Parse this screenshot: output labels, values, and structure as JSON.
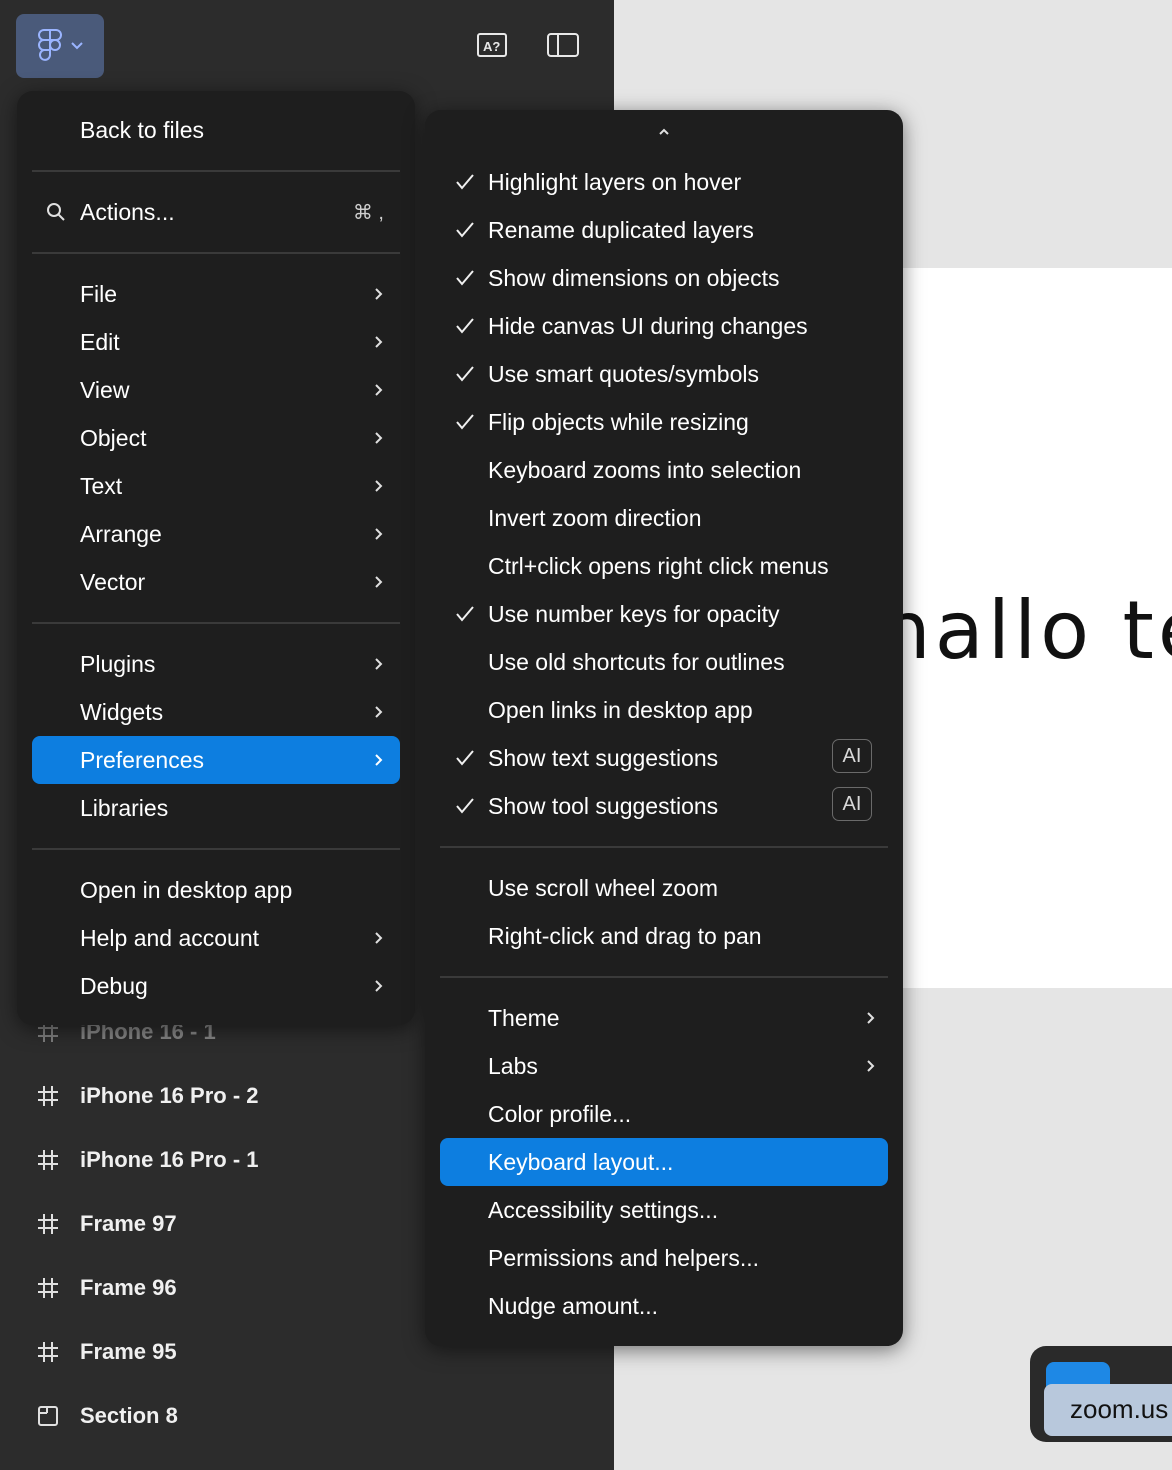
{
  "toolbar": {
    "logo_icon": "figma-logo-icon",
    "dropdown_icon": "chevron-down-icon",
    "font_icon": "missing-fonts-icon",
    "panel_icon": "sidebar-toggle-icon"
  },
  "layers": [
    {
      "name": "iPhone 16 - 1",
      "icon": "frame-icon"
    },
    {
      "name": "iPhone 16 Pro - 2",
      "icon": "frame-icon"
    },
    {
      "name": "iPhone 16 Pro - 1",
      "icon": "frame-icon"
    },
    {
      "name": "Frame 97",
      "icon": "frame-icon"
    },
    {
      "name": "Frame 96",
      "icon": "frame-icon"
    },
    {
      "name": "Frame 95",
      "icon": "frame-icon"
    },
    {
      "name": "Section 8",
      "icon": "section-icon"
    }
  ],
  "canvas": {
    "frame_text": "hallo te"
  },
  "zoom": {
    "tooltip": "zoom.us"
  },
  "main_menu": {
    "back": "Back to files",
    "actions": "Actions...",
    "actions_shortcut": "⌘ ,",
    "items_group1": [
      "File",
      "Edit",
      "View",
      "Object",
      "Text",
      "Arrange",
      "Vector"
    ],
    "items_group2": [
      "Plugins",
      "Widgets",
      "Preferences",
      "Libraries"
    ],
    "items_group3": [
      "Open in desktop app",
      "Help and account",
      "Debug"
    ],
    "active_item": "Preferences"
  },
  "preferences_menu": {
    "toggles": [
      {
        "label": "Highlight layers on hover",
        "checked": true
      },
      {
        "label": "Rename duplicated layers",
        "checked": true
      },
      {
        "label": "Show dimensions on objects",
        "checked": true
      },
      {
        "label": "Hide canvas UI during changes",
        "checked": true
      },
      {
        "label": "Use smart quotes/symbols",
        "checked": true
      },
      {
        "label": "Flip objects while resizing",
        "checked": true
      },
      {
        "label": "Keyboard zooms into selection",
        "checked": false
      },
      {
        "label": "Invert zoom direction",
        "checked": false
      },
      {
        "label": "Ctrl+click opens right click menus",
        "checked": false
      },
      {
        "label": "Use number keys for opacity",
        "checked": true
      },
      {
        "label": "Use old shortcuts for outlines",
        "checked": false
      },
      {
        "label": "Open links in desktop app",
        "checked": false
      },
      {
        "label": "Show text suggestions",
        "checked": true,
        "badge": "AI"
      },
      {
        "label": "Show tool suggestions",
        "checked": true,
        "badge": "AI"
      }
    ],
    "scroll_items": [
      "Use scroll wheel zoom",
      "Right-click and drag to pan"
    ],
    "settings_items": [
      {
        "label": "Theme",
        "submenu": true
      },
      {
        "label": "Labs",
        "submenu": true
      },
      {
        "label": "Color profile...",
        "submenu": false
      },
      {
        "label": "Keyboard layout...",
        "submenu": false
      },
      {
        "label": "Accessibility settings...",
        "submenu": false
      },
      {
        "label": "Permissions and helpers...",
        "submenu": false
      },
      {
        "label": "Nudge amount...",
        "submenu": false
      }
    ],
    "active_item": "Keyboard layout..."
  },
  "colors": {
    "accent": "#0d7ee0",
    "menu_bg": "#1e1e1e",
    "sidebar_bg": "#2c2c2c",
    "canvas_bg": "#e5e5e5"
  }
}
